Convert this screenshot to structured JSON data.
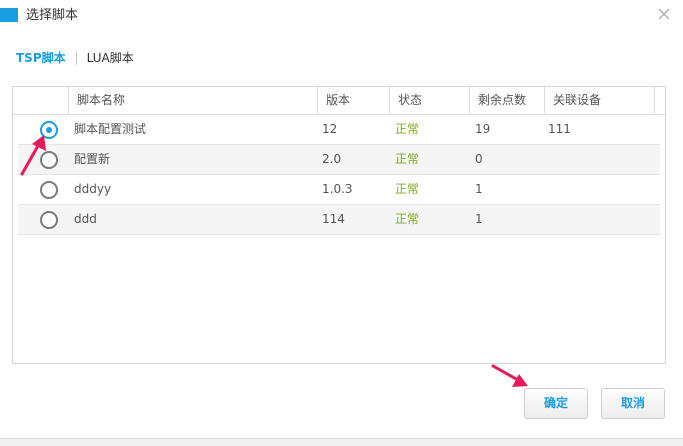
{
  "dialog": {
    "title": "选择脚本",
    "close_icon": "close-icon"
  },
  "tabs": [
    {
      "label": "TSP脚本",
      "active": true
    },
    {
      "label": "LUA脚本",
      "active": false
    }
  ],
  "table": {
    "columns": [
      "脚本名称",
      "版本",
      "状态",
      "剩余点数",
      "关联设备"
    ],
    "rows": [
      {
        "name": "脚本配置测试",
        "version": "12",
        "status": "正常",
        "points": "19",
        "devices": "111",
        "selected": true
      },
      {
        "name": "配置新",
        "version": "2.0",
        "status": "正常",
        "points": "0",
        "devices": "",
        "selected": false
      },
      {
        "name": "dddyy",
        "version": "1.0.3",
        "status": "正常",
        "points": "1",
        "devices": "",
        "selected": false
      },
      {
        "name": "ddd",
        "version": "114",
        "status": "正常",
        "points": "1",
        "devices": "",
        "selected": false
      }
    ]
  },
  "buttons": {
    "confirm_label": "确定",
    "cancel_label": "取消"
  },
  "colors": {
    "accent": "#1a9ee2",
    "status_ok": "#7cae1d",
    "annotation_arrow": "#e8195b"
  }
}
